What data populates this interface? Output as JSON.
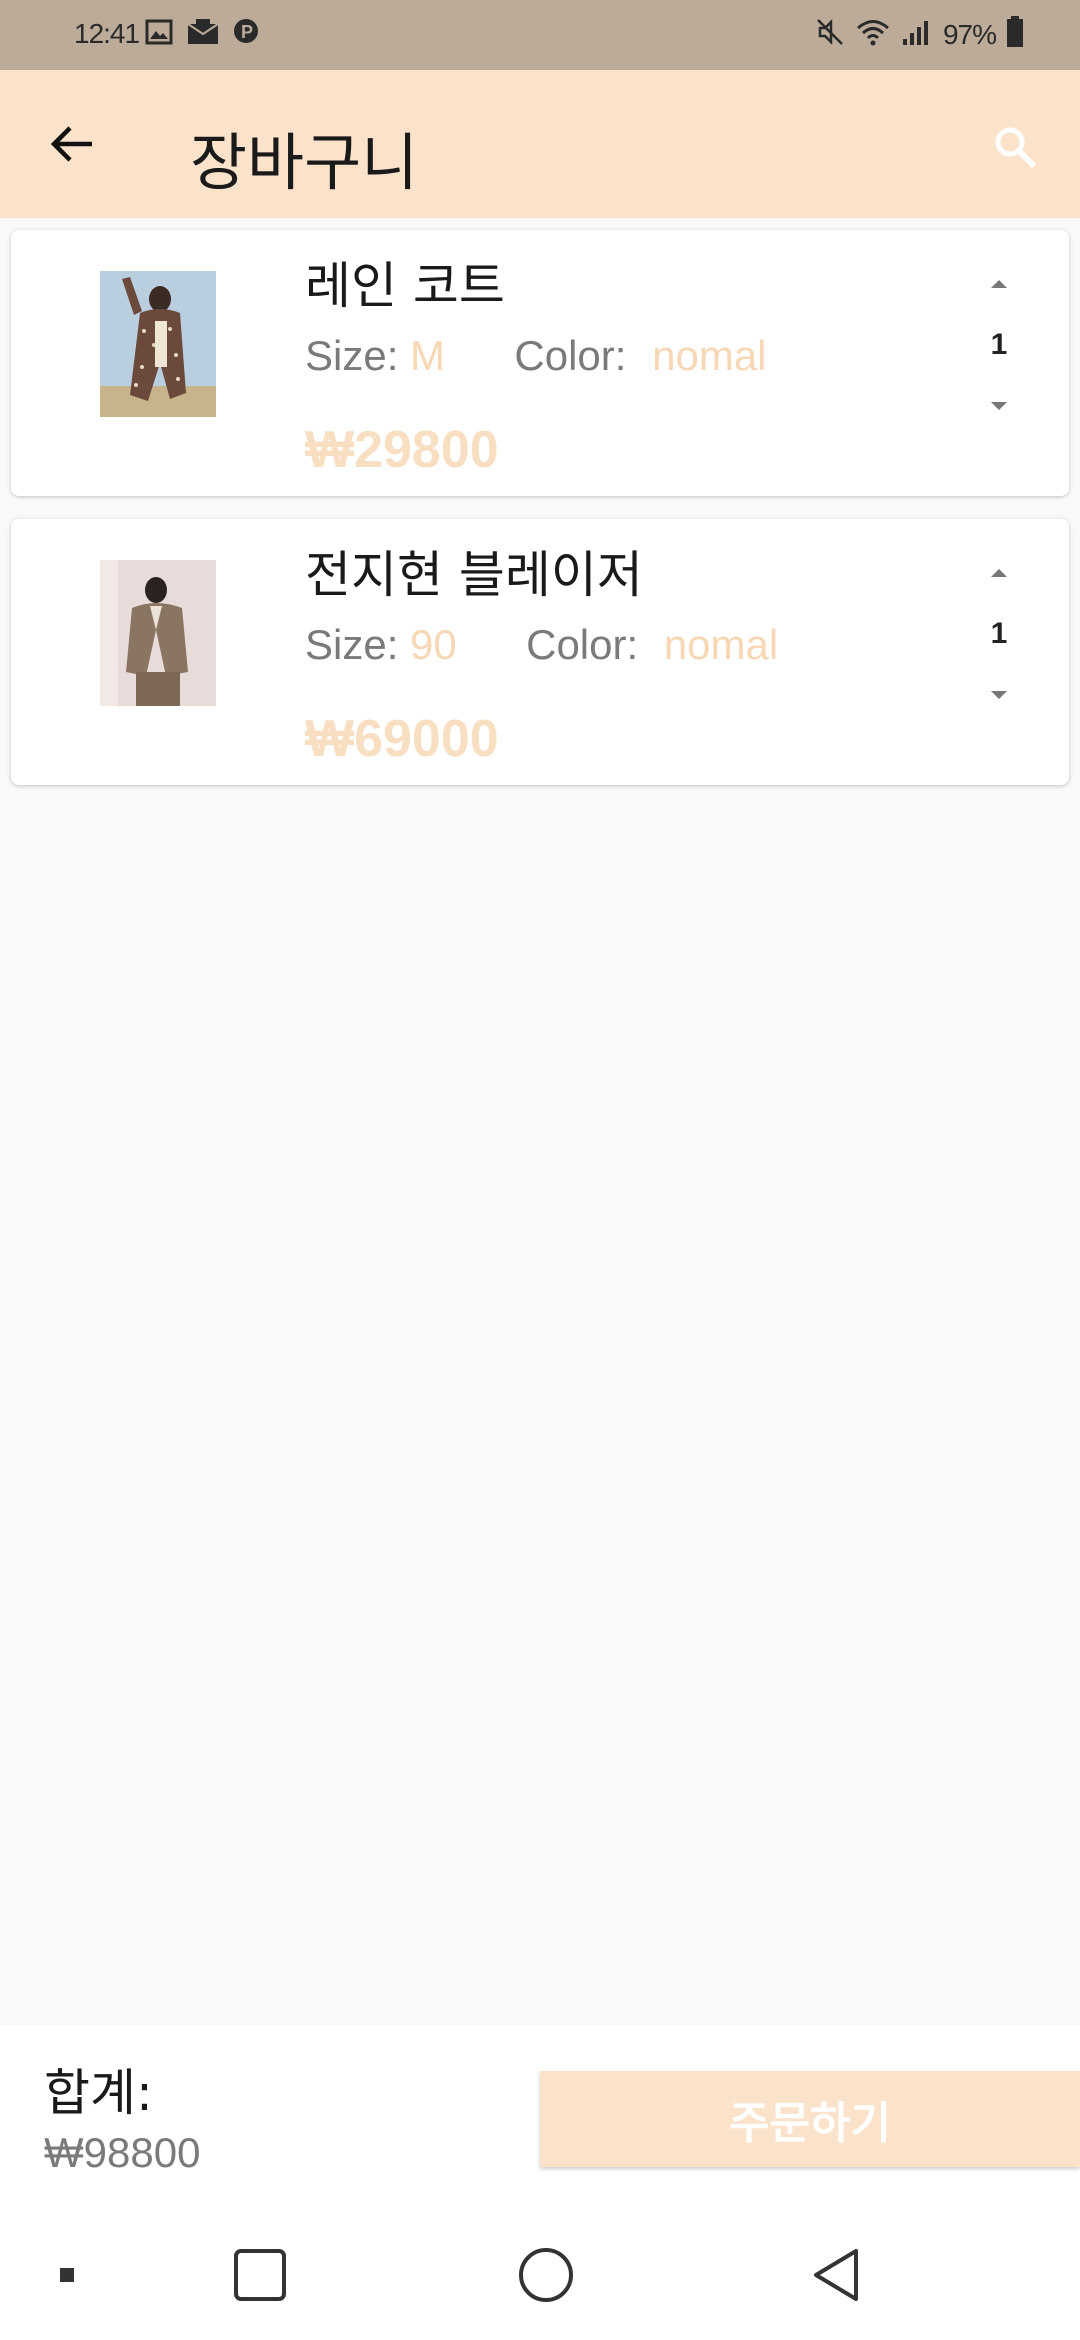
{
  "status_bar": {
    "time": "12:41",
    "battery_percent": "97%",
    "left_icons": [
      "gallery-icon",
      "mail-icon",
      "p-icon"
    ],
    "right_icons": [
      "mute-icon",
      "wifi-icon",
      "signal-icon",
      "battery-icon"
    ]
  },
  "app_bar": {
    "title": "장바구니",
    "back_icon": "arrow-left-icon",
    "search_icon": "search-icon"
  },
  "cart": {
    "items": [
      {
        "name": "레인 코트",
        "size_label": "Size:",
        "size": "M",
        "color_label": "Color:",
        "color": "nomal",
        "price": "₩29800",
        "quantity": "1"
      },
      {
        "name": "전지현 블레이저",
        "size_label": "Size:",
        "size": "90",
        "color_label": "Color:",
        "color": "nomal",
        "price": "₩69000",
        "quantity": "1"
      }
    ]
  },
  "summary": {
    "total_label": "합계:",
    "total_value": "₩98800",
    "order_button": "주문하기"
  },
  "colors": {
    "status_bar": "#bcab99",
    "app_bar": "#fbe3cb",
    "accent_text": "#f7d7b4",
    "background": "#f9f9f9"
  }
}
